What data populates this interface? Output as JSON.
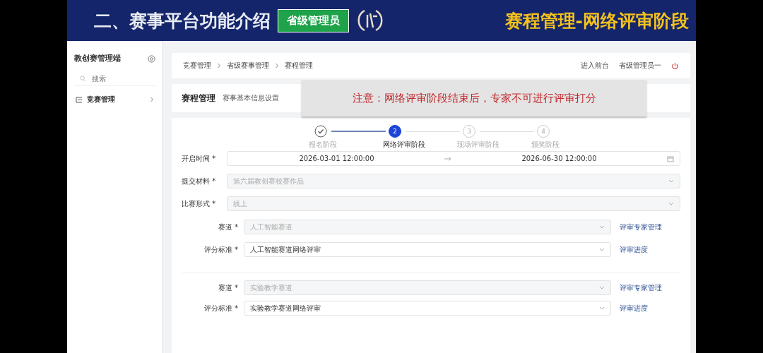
{
  "banner": {
    "section_title": "二、赛事平台功能介绍",
    "role_badge": "省级管理员",
    "page_title": "赛程管理-网络评审阶段"
  },
  "sidebar": {
    "title": "教创赛管理端",
    "search": {
      "placeholder": "搜索"
    },
    "items": [
      {
        "label": "竞赛管理",
        "expanded": false
      }
    ]
  },
  "topbar": {
    "breadcrumbs": [
      "竞赛管理",
      "省级赛事管理",
      "赛程管理"
    ],
    "links": [
      "进入前台"
    ],
    "user": "省级管理员一"
  },
  "page_header": {
    "title": "赛程管理",
    "subtitle": "赛事基本信息设置"
  },
  "notice": "注意：网络评审阶段结束后，专家不可进行评审打分",
  "steps": [
    {
      "label": "报名阶段",
      "done": true,
      "selected": false
    },
    {
      "number": "2",
      "label": "网络评审阶段",
      "done": false,
      "selected": true
    },
    {
      "number": "3",
      "label": "现场评审阶段",
      "done": false,
      "selected": false
    },
    {
      "number": "4",
      "label": "颁奖阶段",
      "done": false,
      "selected": false
    }
  ],
  "form": [
    {
      "kind": "range",
      "label": "开启时间 *",
      "start": "2026-03-01 12:00:00",
      "end": "2026-06-30 12:00:00"
    },
    {
      "kind": "select",
      "label": "提交材料 *",
      "value": "第六届教创赛校赛作品",
      "disabled": true
    },
    {
      "kind": "select",
      "label": "比赛形式 *",
      "value": "线上",
      "disabled": true
    }
  ],
  "tracks": [
    {
      "fields": [
        {
          "label": "赛道 *",
          "value": "人工智能赛道",
          "disabled": true,
          "link": "评审专家管理"
        },
        {
          "label": "评分标准 *",
          "value": "人工智能赛道网络评审",
          "disabled": false,
          "link": "评审进度"
        }
      ]
    },
    {
      "fields": [
        {
          "label": "赛道 *",
          "value": "实验教学赛道",
          "disabled": true,
          "link": "评审专家管理"
        },
        {
          "label": "评分标准 *",
          "value": "实验教学赛道网络评审",
          "disabled": false,
          "link": "评审进度"
        }
      ]
    }
  ]
}
